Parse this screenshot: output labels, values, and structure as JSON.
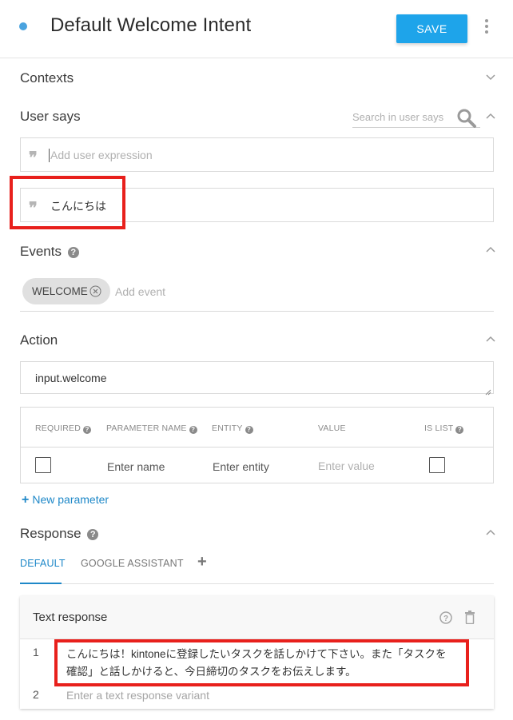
{
  "header": {
    "title": "Default Welcome Intent",
    "save_label": "SAVE"
  },
  "contexts": {
    "title": "Contexts"
  },
  "user_says": {
    "title": "User says",
    "search_placeholder": "Search in user says",
    "add_placeholder": "Add user expression",
    "expressions": [
      "こんにちは"
    ]
  },
  "events": {
    "title": "Events",
    "help": "?",
    "chips": [
      "WELCOME"
    ],
    "add_placeholder": "Add event"
  },
  "action": {
    "title": "Action",
    "value": "input.welcome",
    "table": {
      "headers": {
        "required": "REQUIRED",
        "parameter_name": "PARAMETER NAME",
        "entity": "ENTITY",
        "value": "VALUE",
        "is_list": "IS LIST"
      },
      "row": {
        "name_placeholder": "Enter name",
        "entity_placeholder": "Enter entity",
        "value_placeholder": "Enter value"
      }
    },
    "new_parameter": "New parameter",
    "plus": "+"
  },
  "response": {
    "title": "Response",
    "help": "?",
    "tabs": [
      "DEFAULT",
      "GOOGLE ASSISTANT"
    ],
    "add_tab": "+",
    "active_tab": "DEFAULT",
    "card": {
      "title": "Text response",
      "rows": [
        {
          "num": "1",
          "line1": "こんにちは！kintoneに登録したいタスクを話しかけて下さい。また「タスクを",
          "line2": "確認」と話しかけると、今日締切のタスクをお伝えします。"
        },
        {
          "num": "2",
          "placeholder": "Enter a text response variant"
        }
      ]
    }
  },
  "colors": {
    "accent": "#1ea4ea",
    "highlight": "#e8201c",
    "tab_active": "#1e88c8"
  }
}
